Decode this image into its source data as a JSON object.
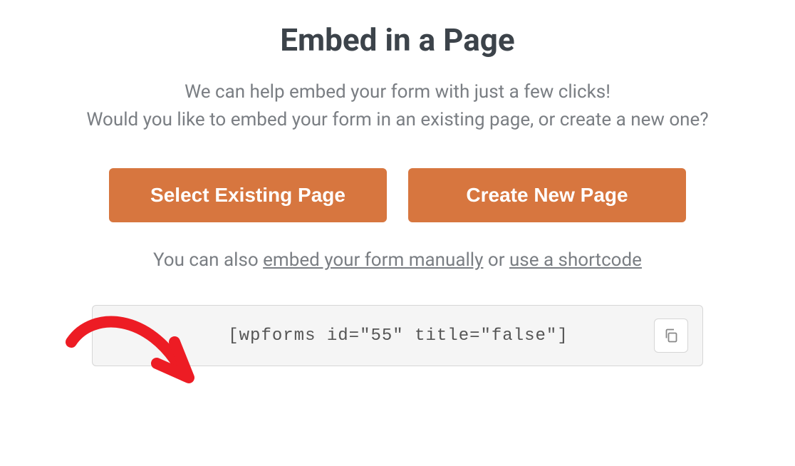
{
  "heading": "Embed in a Page",
  "subheading": "We can help embed your form with just a few clicks!\nWould you like to embed your form in an existing page, or create a new one?",
  "buttons": {
    "select_existing": "Select Existing Page",
    "create_new": "Create New Page"
  },
  "helper": {
    "prefix": "You can also ",
    "link_manual": "embed your form manually",
    "middle": " or ",
    "link_shortcode": "use a shortcode"
  },
  "shortcode": "[wpforms id=\"55\" title=\"false\"]",
  "colors": {
    "primary_button": "#d7763f",
    "heading_text": "#3c434a",
    "body_text": "#7a7e83",
    "annotation": "#ed1c24"
  }
}
